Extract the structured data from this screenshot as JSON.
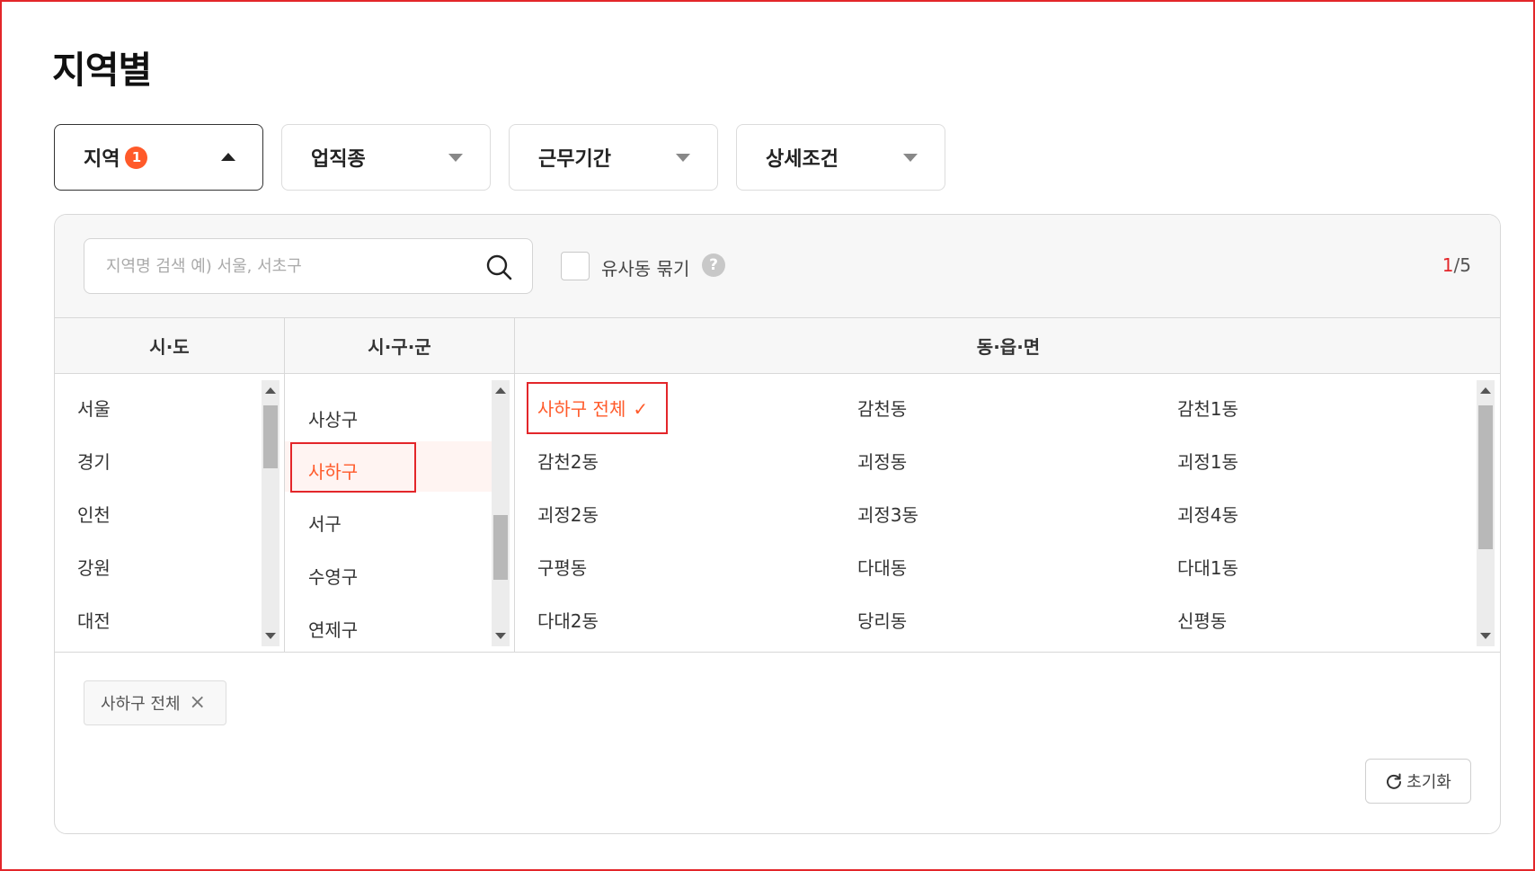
{
  "title": "지역별",
  "filters": [
    {
      "label": "지역",
      "badge": "1"
    },
    {
      "label": "업직종"
    },
    {
      "label": "근무기간"
    },
    {
      "label": "상세조건"
    }
  ],
  "search": {
    "placeholder": "지역명 검색 예) 서울, 서초구",
    "value": ""
  },
  "similar": {
    "label": "유사동 묶기",
    "help": "?"
  },
  "counter": {
    "current": "1",
    "total": "/5"
  },
  "columns": {
    "sido": {
      "header": "시·도",
      "items": [
        "서울",
        "경기",
        "인천",
        "강원",
        "대전"
      ]
    },
    "sigungu": {
      "header": "시·구·군",
      "items": [
        "사상구",
        "사하구",
        "서구",
        "수영구",
        "연제구"
      ],
      "selected": "사하구"
    },
    "dong": {
      "header": "동·읍·면",
      "items": [
        "사하구 전체",
        "감천동",
        "감천1동",
        "감천2동",
        "괴정동",
        "괴정1동",
        "괴정2동",
        "괴정3동",
        "괴정4동",
        "구평동",
        "다대동",
        "다대1동",
        "다대2동",
        "당리동",
        "신평동"
      ],
      "selected": "사하구 전체"
    }
  },
  "selected_chip": {
    "label": "사하구 전체",
    "close": "×"
  },
  "reset": {
    "label": "초기화"
  },
  "colors": {
    "accent": "#ff5a2a",
    "highlight": "#e3262a"
  }
}
